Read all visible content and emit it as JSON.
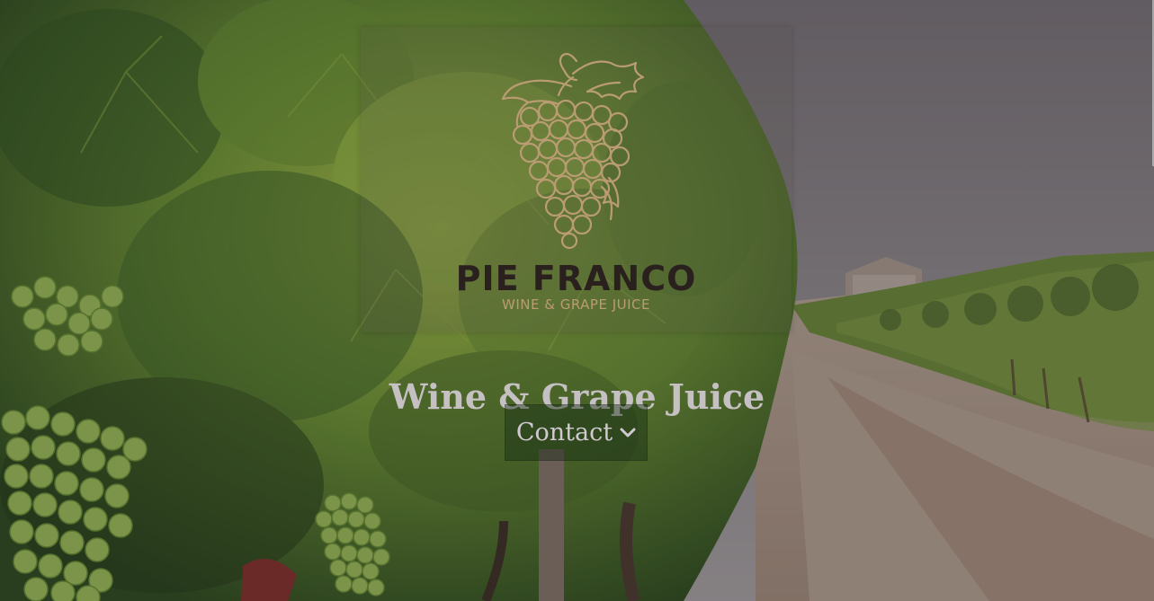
{
  "hero": {
    "brand_name": "PIE FRANCO",
    "brand_tagline": "WINE & GRAPE JUICE",
    "headline": "Wine & Grape Juice",
    "contact_label": "Contact",
    "contact_icon": "chevron-down-icon",
    "logo_icon": "grape-bunch-icon"
  },
  "colors": {
    "logo_gold": "#b99c72",
    "logo_dark": "#2a211f",
    "headline": "#c5c0c1",
    "button_text": "#d1c9d0"
  }
}
